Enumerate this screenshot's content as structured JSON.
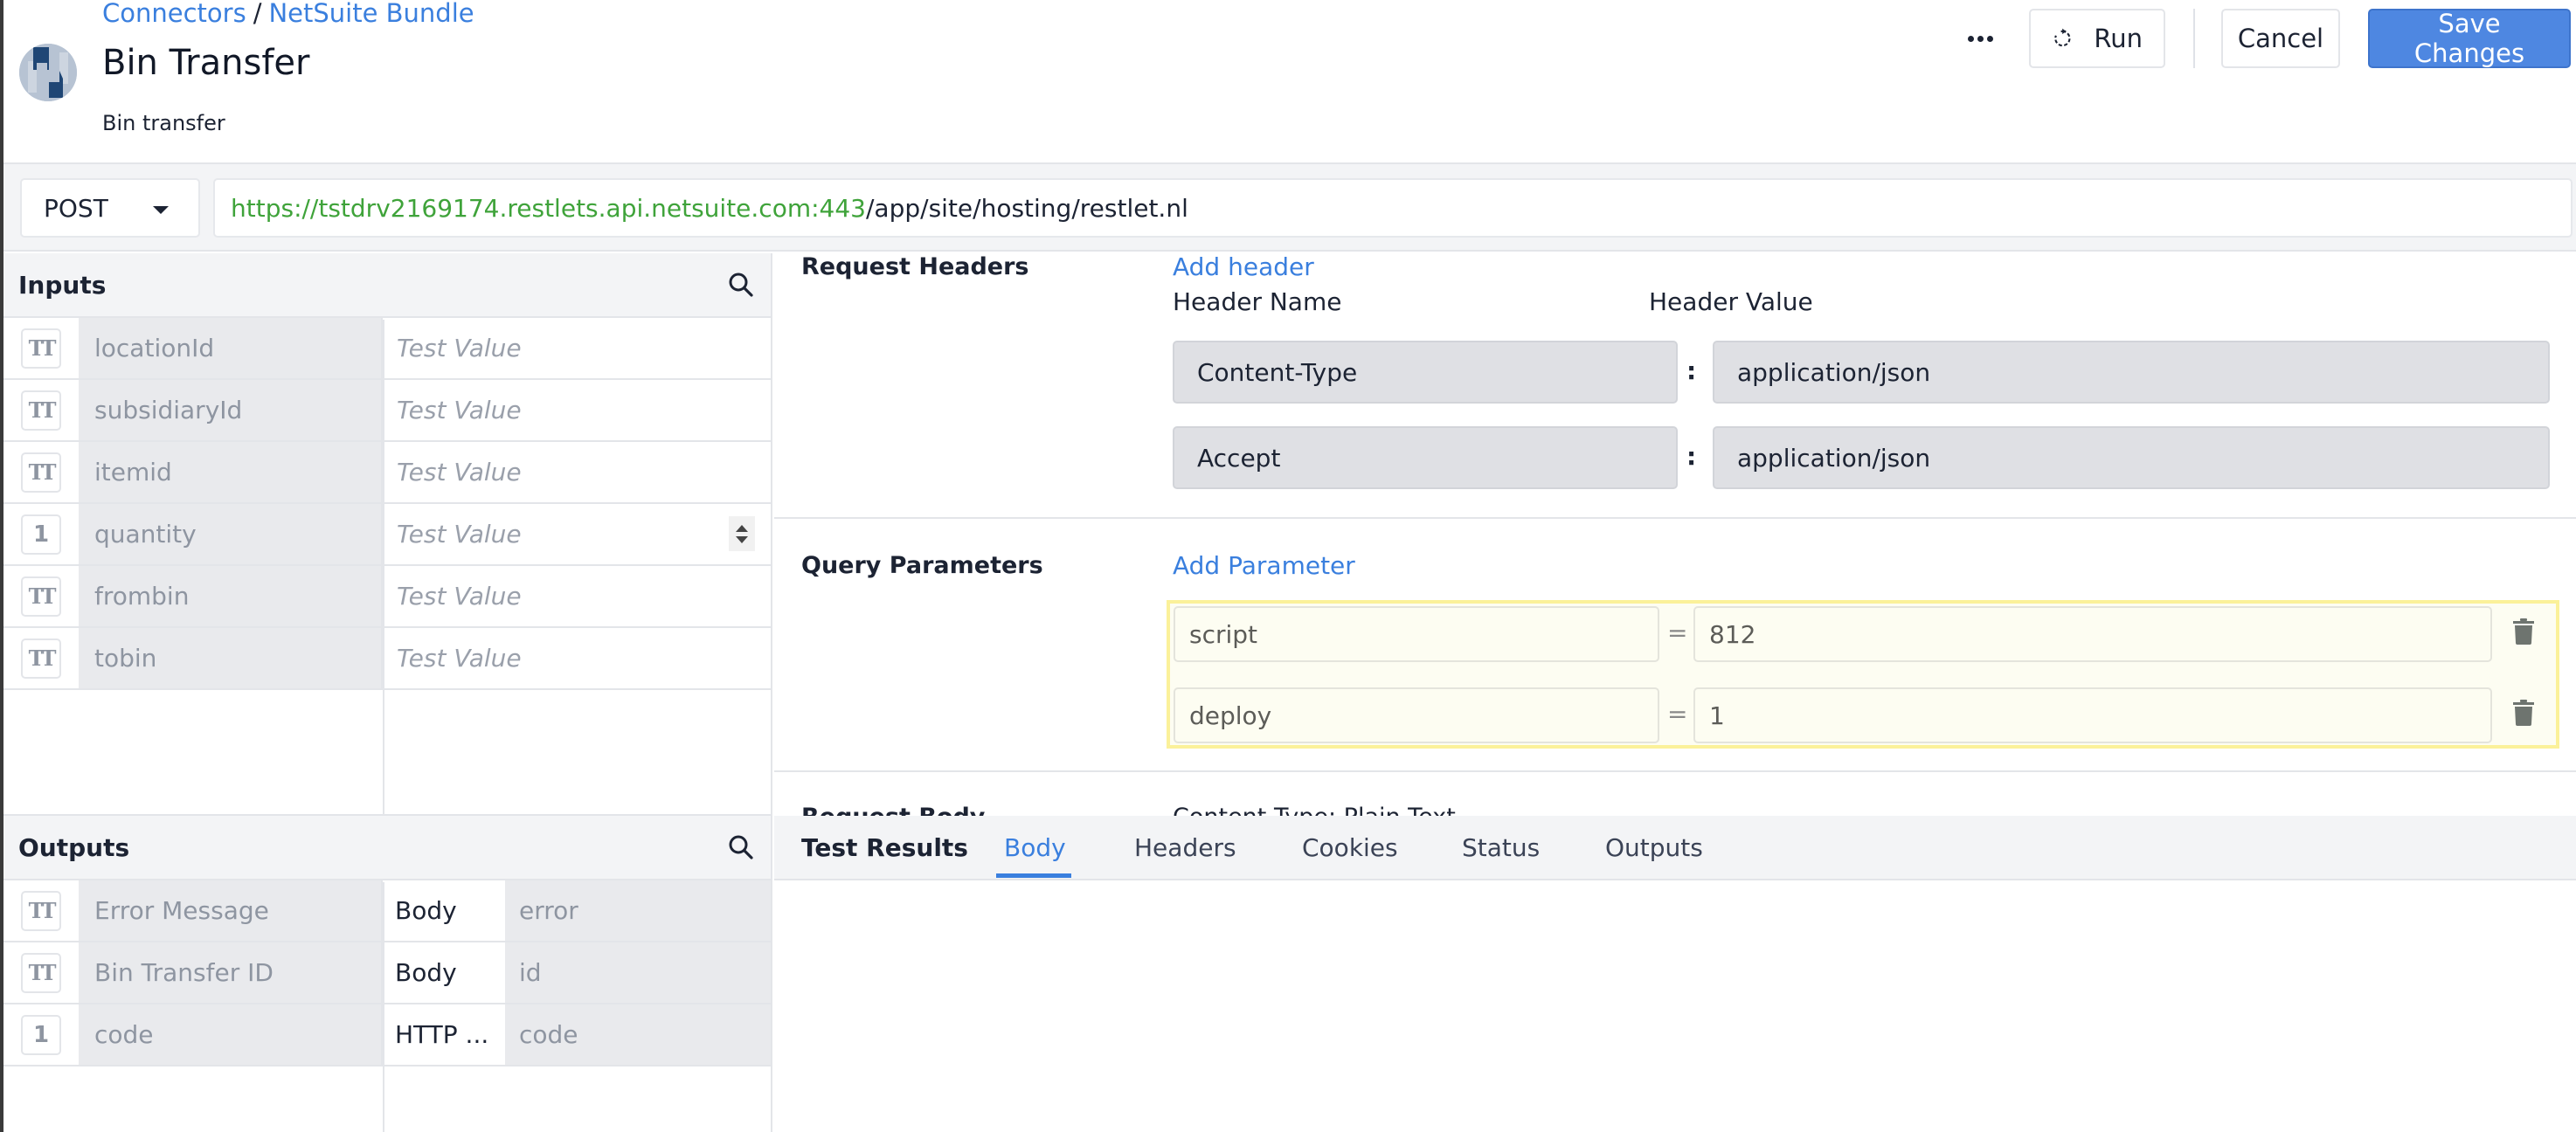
{
  "header": {
    "breadcrumb": [
      {
        "label": "Connectors"
      },
      {
        "label": "NetSuite Bundle"
      }
    ],
    "breadcrumb_separator": "/",
    "title": "Bin Transfer",
    "subtitle": "Bin transfer",
    "logo_icon": "netsuite-logo",
    "actions": {
      "more_label": "…",
      "run_label": "Run",
      "cancel_label": "Cancel",
      "save_label": "Save Changes"
    }
  },
  "request": {
    "method": "POST",
    "url_base": "https://tstdrv2169174.restlets.api.netsuite.com:443",
    "url_path": "/app/site/hosting/restlet.nl"
  },
  "inputs": {
    "title": "Inputs",
    "value_placeholder": "Test Value",
    "rows": [
      {
        "type": "text",
        "type_glyph": "TT",
        "name": "locationId",
        "value": ""
      },
      {
        "type": "text",
        "type_glyph": "TT",
        "name": "subsidiaryId",
        "value": ""
      },
      {
        "type": "text",
        "type_glyph": "TT",
        "name": "itemid",
        "value": ""
      },
      {
        "type": "number",
        "type_glyph": "1",
        "name": "quantity",
        "value": ""
      },
      {
        "type": "text",
        "type_glyph": "TT",
        "name": "frombin",
        "value": ""
      },
      {
        "type": "text",
        "type_glyph": "TT",
        "name": "tobin",
        "value": ""
      }
    ]
  },
  "outputs": {
    "title": "Outputs",
    "rows": [
      {
        "type": "text",
        "type_glyph": "TT",
        "name": "Error Message",
        "source": "Body",
        "path": "error"
      },
      {
        "type": "text",
        "type_glyph": "TT",
        "name": "Bin Transfer ID",
        "source": "Body",
        "path": "id"
      },
      {
        "type": "number",
        "type_glyph": "1",
        "name": "code",
        "source": "HTTP ...",
        "path": "code"
      }
    ]
  },
  "request_headers": {
    "label": "Request Headers",
    "add_label": "Add header",
    "name_col": "Header Name",
    "value_col": "Header Value",
    "separator": ":",
    "rows": [
      {
        "name": "Content-Type",
        "value": "application/json"
      },
      {
        "name": "Accept",
        "value": "application/json"
      }
    ]
  },
  "query_parameters": {
    "label": "Query Parameters",
    "add_label": "Add Parameter",
    "separator": "=",
    "rows": [
      {
        "name": "script",
        "value": "812"
      },
      {
        "name": "deploy",
        "value": "1"
      }
    ]
  },
  "request_body": {
    "label": "Request Body",
    "content_type": "Content Type: Plain Text"
  },
  "test_results": {
    "title": "Test Results",
    "tabs": [
      {
        "label": "Body",
        "active": true
      },
      {
        "label": "Headers",
        "active": false
      },
      {
        "label": "Cookies",
        "active": false
      },
      {
        "label": "Status",
        "active": false
      },
      {
        "label": "Outputs",
        "active": false
      }
    ]
  },
  "colors": {
    "accent": "#3a7fde",
    "save_button": "#4e87e1",
    "url_base": "#3fa33a",
    "param_highlight_border": "#fbf19a"
  }
}
